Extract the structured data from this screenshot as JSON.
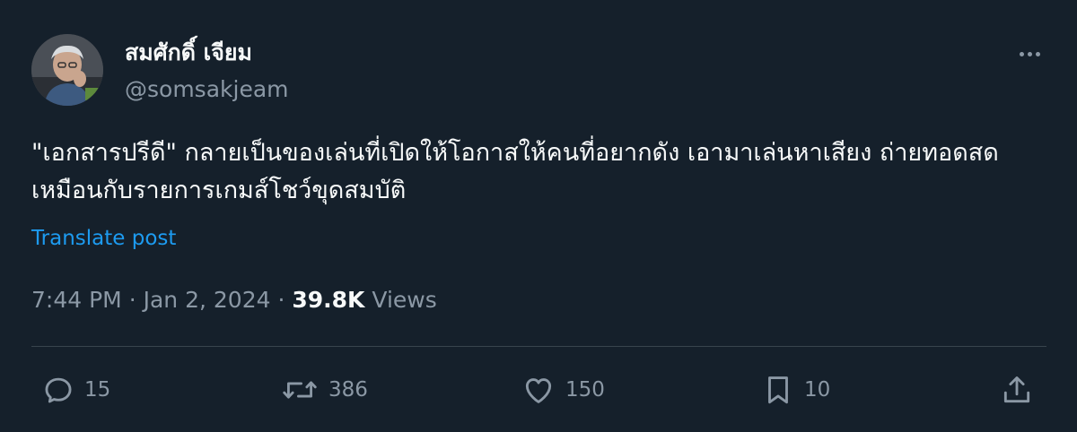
{
  "author": {
    "display_name": "สมศักดิ์ เจียม",
    "handle": "@somsakjeam"
  },
  "post": {
    "text": "\"เอกสารปรีดี\" กลายเป็นของเล่นที่เปิดให้โอกาสให้คนที่อยากดัง เอามาเล่นหาเสียง ถ่ายทอดสด เหมือนกับรายการเกมส์โชว์ขุดสมบัติ",
    "translate_label": "Translate post",
    "time": "7:44 PM",
    "separator": "·",
    "date": "Jan 2, 2024",
    "views_count": "39.8K",
    "views_label": "Views"
  },
  "actions": {
    "replies": "15",
    "reposts": "386",
    "likes": "150",
    "bookmarks": "10"
  },
  "icons": {
    "more": "more-horizontal-icon",
    "reply": "reply-icon",
    "repost": "repost-icon",
    "like": "heart-icon",
    "bookmark": "bookmark-icon",
    "share": "share-icon"
  },
  "colors": {
    "background": "#15202b",
    "text": "#f7f9f9",
    "muted": "#8b98a5",
    "accent": "#1d9bf0",
    "divider": "#38444d"
  }
}
